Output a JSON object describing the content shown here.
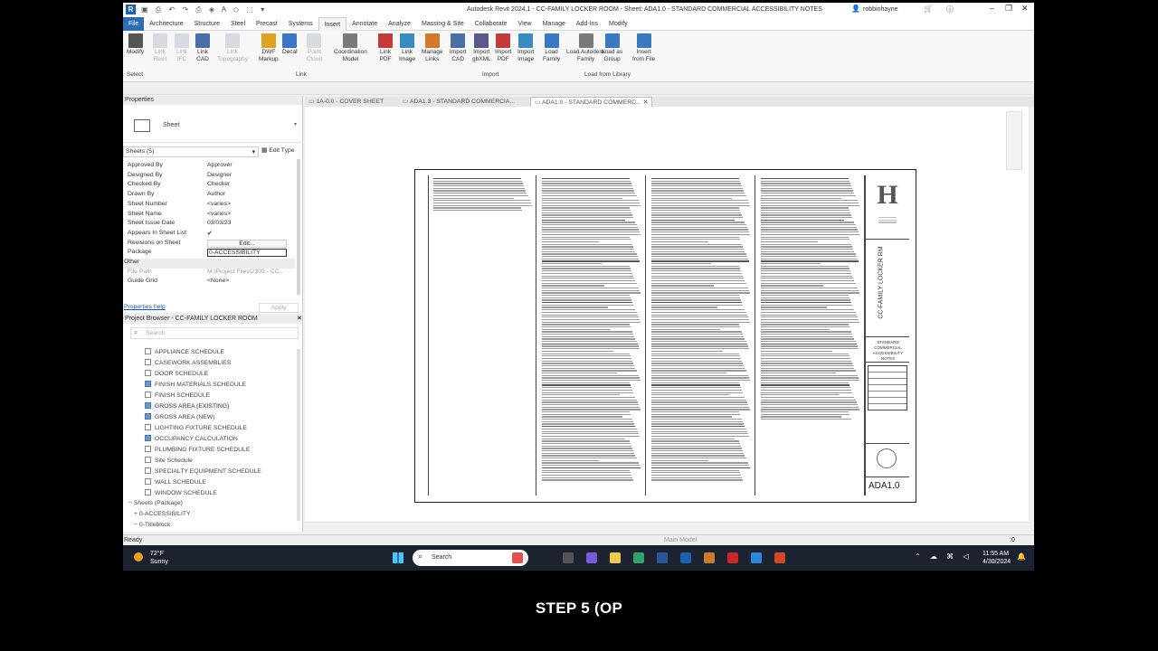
{
  "window_title": "Autodesk Revit 2024.1 - CC-FAMILY LOCKER ROOM - Sheet: ADA1.0 - STANDARD COMMERCIAL ACCESSIBILITY NOTES",
  "user": "robbinhayne",
  "ribbon_tabs": [
    "File",
    "Architecture",
    "Structure",
    "Steel",
    "Precast",
    "Systems",
    "Insert",
    "Annotate",
    "Analyze",
    "Massing & Site",
    "Collaborate",
    "View",
    "Manage",
    "Add-Ins",
    "Modify"
  ],
  "active_tab": "Insert",
  "tools": [
    {
      "label": "Modify",
      "color": "#555555",
      "enabled": true
    },
    {
      "label": "Link\nRevit",
      "color": "#9aa6b8",
      "enabled": false
    },
    {
      "label": "Link\nIFC",
      "color": "#9aa6b8",
      "enabled": false
    },
    {
      "label": "Link\nCAD",
      "color": "#4a6fa5",
      "enabled": true
    },
    {
      "label": "Link\nTopography",
      "color": "#9aa6b8",
      "enabled": false
    },
    {
      "label": "DWF\nMarkup",
      "color": "#e0a020",
      "enabled": true
    },
    {
      "label": "Decal",
      "color": "#3a78c2",
      "enabled": true
    },
    {
      "label": "Point\nCloud",
      "color": "#9aa6b8",
      "enabled": false
    },
    {
      "label": "Coordination\nModel",
      "color": "#7a7a7a",
      "enabled": true
    },
    {
      "label": "Link\nPDF",
      "color": "#c23a3a",
      "enabled": true
    },
    {
      "label": "Link\nImage",
      "color": "#3a8ac2",
      "enabled": true
    },
    {
      "label": "Manage\nLinks",
      "color": "#d07a30",
      "enabled": true
    },
    {
      "label": "Import\nCAD",
      "color": "#4a6fa5",
      "enabled": true
    },
    {
      "label": "Import\ngbXML",
      "color": "#5a5a8a",
      "enabled": true
    },
    {
      "label": "Import\nPDF",
      "color": "#c23a3a",
      "enabled": true
    },
    {
      "label": "Import\nImage",
      "color": "#3a8ac2",
      "enabled": true
    },
    {
      "label": "Load\nFamily",
      "color": "#3a78c2",
      "enabled": true
    },
    {
      "label": "Load Autodesk\nFamily",
      "color": "#7a7a7a",
      "enabled": true
    },
    {
      "label": "Load as\nGroup",
      "color": "#3a78c2",
      "enabled": true
    },
    {
      "label": "Insert\nfrom File",
      "color": "#3a78c2",
      "enabled": true
    }
  ],
  "groups": {
    "select": "Select",
    "link": "Link",
    "import": "Import",
    "load": "Load from Library"
  },
  "properties": {
    "title": "Properties",
    "type": "Sheet",
    "selector": "Sheets (5)",
    "edit_type": "Edit Type",
    "rows": [
      {
        "k": "Approved By",
        "v": "Approver"
      },
      {
        "k": "Designed By",
        "v": "Designer"
      },
      {
        "k": "Checked By",
        "v": "Checker"
      },
      {
        "k": "Drawn By",
        "v": "Author"
      },
      {
        "k": "Sheet Number",
        "v": "<varies>"
      },
      {
        "k": "Sheet Name",
        "v": "<varies>"
      },
      {
        "k": "Sheet Issue Date",
        "v": "03/03/23"
      },
      {
        "k": "Appears In Sheet List",
        "v": "✔"
      },
      {
        "k": "Revisions on Sheet",
        "v": "Edit..."
      },
      {
        "k": "Package",
        "v": "0-ACCESSIBILITY"
      },
      {
        "k": "Other",
        "v": ""
      },
      {
        "k": "File Path",
        "v": "M:\\Project Files\\2309 - CC..."
      },
      {
        "k": "Guide Grid",
        "v": "<None>"
      }
    ],
    "help": "Properties help",
    "apply": "Apply"
  },
  "browser": {
    "title": "Project Browser - CC-FAMILY LOCKER ROOM",
    "search_placeholder": "Search",
    "items": [
      {
        "label": "APPLIANCE SCHEDULE",
        "checked": false
      },
      {
        "label": "CASEWORK ASSEMBLIES",
        "checked": false
      },
      {
        "label": "DOOR SCHEDULE",
        "checked": false
      },
      {
        "label": "FINISH MATERIALS SCHEDULE",
        "checked": true
      },
      {
        "label": "FINISH SCHEDULE",
        "checked": false
      },
      {
        "label": "GROSS AREA (EXISTING)",
        "checked": true
      },
      {
        "label": "GROSS AREA (NEW)",
        "checked": true
      },
      {
        "label": "LIGHTING FIXTURE SCHEDULE",
        "checked": false
      },
      {
        "label": "OCCUPANCY CALCULATION",
        "checked": true
      },
      {
        "label": "PLUMBING FIXTURE SCHEDULE",
        "checked": false
      },
      {
        "label": "Site Schedule",
        "checked": false
      },
      {
        "label": "SPECIALTY EQUIPMENT SCHEDULE",
        "checked": false
      },
      {
        "label": "WALL SCHEDULE",
        "checked": false
      },
      {
        "label": "WINDOW SCHEDULE",
        "checked": false
      }
    ],
    "groups": [
      "Sheets (Package)",
      "0-ACCESSIBILITY",
      "0-Titleblock"
    ]
  },
  "view_tabs": [
    "1A-0.0 - COVER SHEET",
    "ADA1.3 - STANDARD COMMERCIA...",
    "ADA1.0 - STANDARD COMMERC..."
  ],
  "sheet": {
    "logo_letter": "H",
    "project": "CC-FAMILY LOCKER RM",
    "sheet_title": "STANDARD COMMERCIAL ACCESSIBILITY NOTES",
    "sheet_number": "ADA1.0"
  },
  "status": {
    "ready": "Ready",
    "model": "Main Model",
    "coord": ":0"
  },
  "taskbar": {
    "temp": "72°F",
    "weather": "Sunny",
    "search": "Search",
    "time": "11:55 AM",
    "date": "4/30/2024"
  },
  "caption": "STEP 5 (OP"
}
